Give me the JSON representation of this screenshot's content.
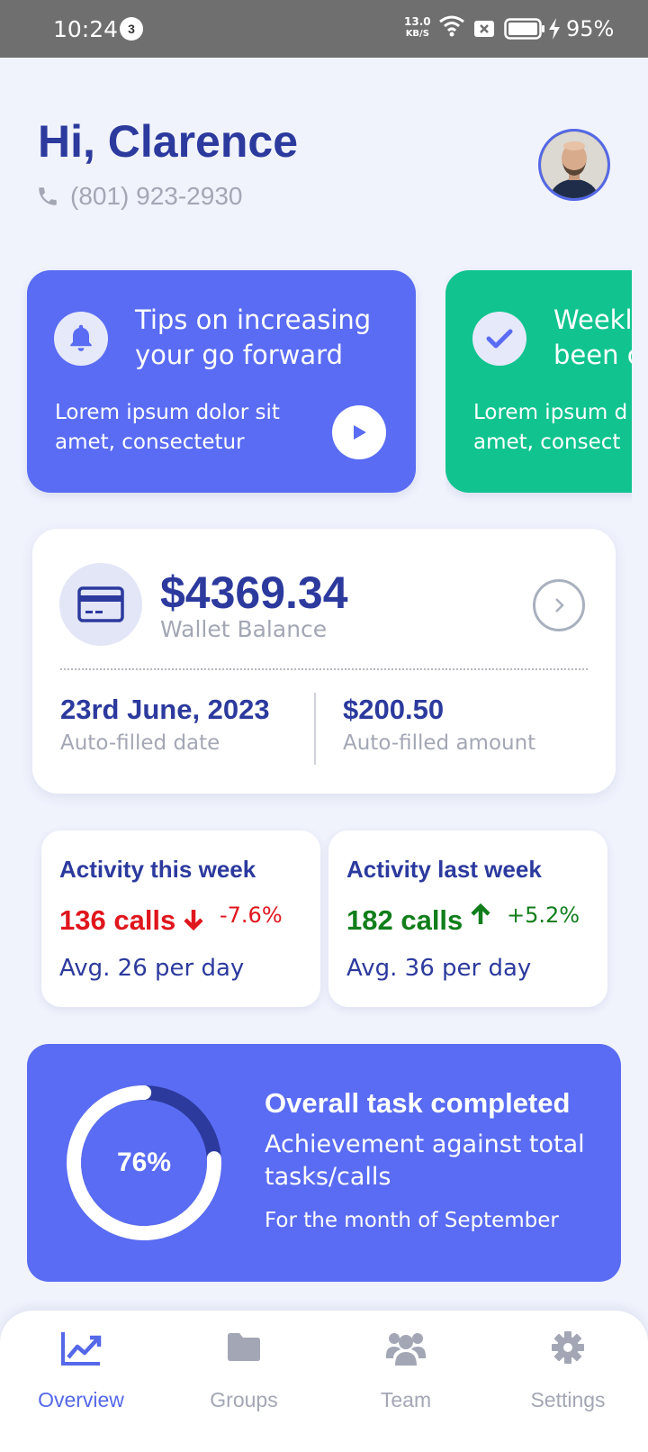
{
  "status_bar": {
    "time": "10:24",
    "notification_count": "3",
    "net_speed_value": "13.0",
    "net_speed_unit": "KB/S",
    "battery_percent": "95%"
  },
  "header": {
    "greeting": "Hi, Clarence",
    "phone": "(801) 923-2930"
  },
  "promos": [
    {
      "title": "Tips on increasing your go forward",
      "text": "Lorem ipsum dolor sit amet, consectetur",
      "icon": "bell-icon",
      "color": "#5a6cf3"
    },
    {
      "title": "Weekly ... been ...",
      "title_visible_line1": "Weekl",
      "title_visible_line2": "been c",
      "text_line1": "Lorem ipsum d",
      "text_line2": "amet, consect",
      "icon": "check-icon",
      "color": "#11c48f"
    }
  ],
  "wallet": {
    "balance": "$4369.34",
    "balance_label": "Wallet Balance",
    "date_value": "23rd June, 2023",
    "date_label": "Auto-filled date",
    "amount_value": "$200.50",
    "amount_label": "Auto-filled amount"
  },
  "activity": {
    "this_week": {
      "title": "Activity this week",
      "calls": "136 calls",
      "change": "-7.6%",
      "trend": "down",
      "avg": "Avg. 26 per day",
      "color": "#e0161d"
    },
    "last_week": {
      "title": "Activity last week",
      "calls": "182 calls",
      "change": "+5.2%",
      "trend": "up",
      "avg": "Avg. 36 per day",
      "color": "#117e1b"
    }
  },
  "task": {
    "percent_label": "76%",
    "percent_value": 76,
    "title": "Overall task completed",
    "subtitle": "Achievement against total tasks/calls",
    "period": "For the month of September"
  },
  "nav": {
    "items": [
      {
        "label": "Overview",
        "icon": "chart-line-icon",
        "active": true
      },
      {
        "label": "Groups",
        "icon": "folder-icon",
        "active": false
      },
      {
        "label": "Team",
        "icon": "users-icon",
        "active": false
      },
      {
        "label": "Settings",
        "icon": "gear-icon",
        "active": false
      }
    ]
  },
  "colors": {
    "primary": "#2c3a9e",
    "accent": "#5a6cf3",
    "green": "#11c48f",
    "muted": "#a3a7b5",
    "background": "#f0f3fc"
  }
}
